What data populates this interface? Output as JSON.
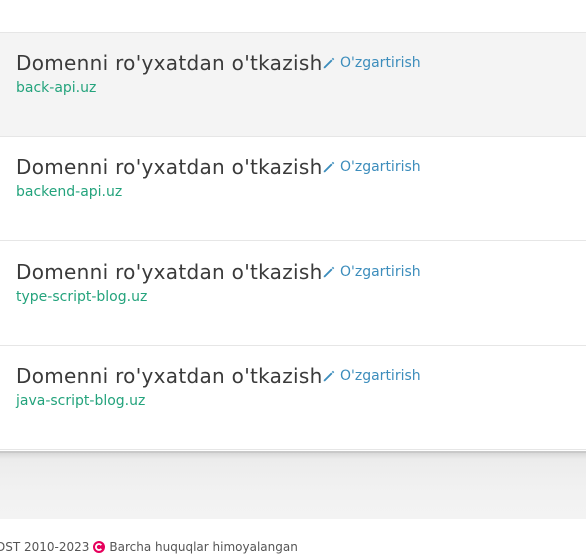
{
  "domains": {
    "items": [
      {
        "title": "Domenni ro'yxatdan o'tkazish",
        "edit_label": "O'zgartirish",
        "domain": "back-api.uz"
      },
      {
        "title": "Domenni ro'yxatdan o'tkazish",
        "edit_label": "O'zgartirish",
        "domain": "backend-api.uz"
      },
      {
        "title": "Domenni ro'yxatdan o'tkazish",
        "edit_label": "O'zgartirish",
        "domain": "type-script-blog.uz"
      },
      {
        "title": "Domenni ro'yxatdan o'tkazish",
        "edit_label": "O'zgartirish",
        "domain": "java-script-blog.uz"
      }
    ]
  },
  "footer": {
    "copyright": "DST 2010-2023",
    "rights": "Barcha huquqlar himoyalangan"
  },
  "colors": {
    "link": "#3c8dbc",
    "domain": "#23a37c",
    "logo": "#e6005c"
  }
}
